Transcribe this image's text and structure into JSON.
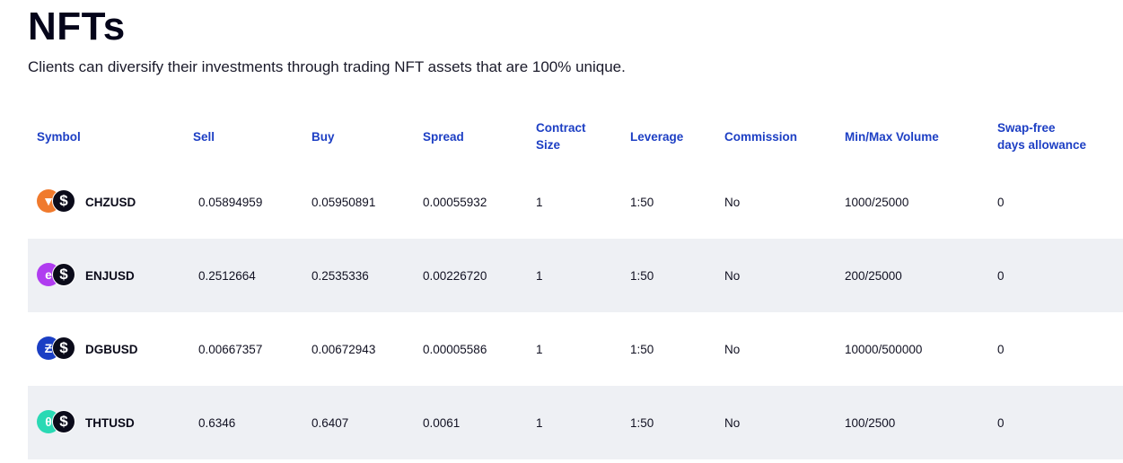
{
  "header": {
    "title": "NFTs",
    "subtitle": "Clients can diversify their investments through trading NFT assets that are 100% unique."
  },
  "table": {
    "columns": {
      "symbol": "Symbol",
      "sell": "Sell",
      "buy": "Buy",
      "spread": "Spread",
      "contract_size_1": "Contract",
      "contract_size_2": "Size",
      "leverage": "Leverage",
      "commission": "Commission",
      "volume": "Min/Max Volume",
      "swap_1": "Swap-free",
      "swap_2": "days allowance"
    },
    "rows": [
      {
        "symbol": "CHZUSD",
        "coin_icon": "chiliz-icon",
        "coin_color": "#f07a2d",
        "coin_glyph": "▼",
        "sell": "0.05894959",
        "buy": "0.05950891",
        "spread": "0.00055932",
        "contract_size": "1",
        "leverage": "1:50",
        "commission": "No",
        "volume": "1000/25000",
        "swap": "0"
      },
      {
        "symbol": "ENJUSD",
        "coin_icon": "enjin-icon",
        "coin_color": "#b03cf0",
        "coin_glyph": "e",
        "sell": "0.2512664",
        "buy": "0.2535336",
        "spread": "0.00226720",
        "contract_size": "1",
        "leverage": "1:50",
        "commission": "No",
        "volume": "200/25000",
        "swap": "0"
      },
      {
        "symbol": "DGBUSD",
        "coin_icon": "digibyte-icon",
        "coin_color": "#1b3fc4",
        "coin_glyph": "Ƶ",
        "sell": "0.00667357",
        "buy": "0.00672943",
        "spread": "0.00005586",
        "contract_size": "1",
        "leverage": "1:50",
        "commission": "No",
        "volume": "10000/500000",
        "swap": "0"
      },
      {
        "symbol": "THTUSD",
        "coin_icon": "theta-icon",
        "coin_color": "#2ad9b4",
        "coin_glyph": "θ",
        "sell": "0.6346",
        "buy": "0.6407",
        "spread": "0.0061",
        "contract_size": "1",
        "leverage": "1:50",
        "commission": "No",
        "volume": "100/2500",
        "swap": "0"
      }
    ],
    "usd_icon": "dollar-icon",
    "usd_glyph": "$"
  }
}
